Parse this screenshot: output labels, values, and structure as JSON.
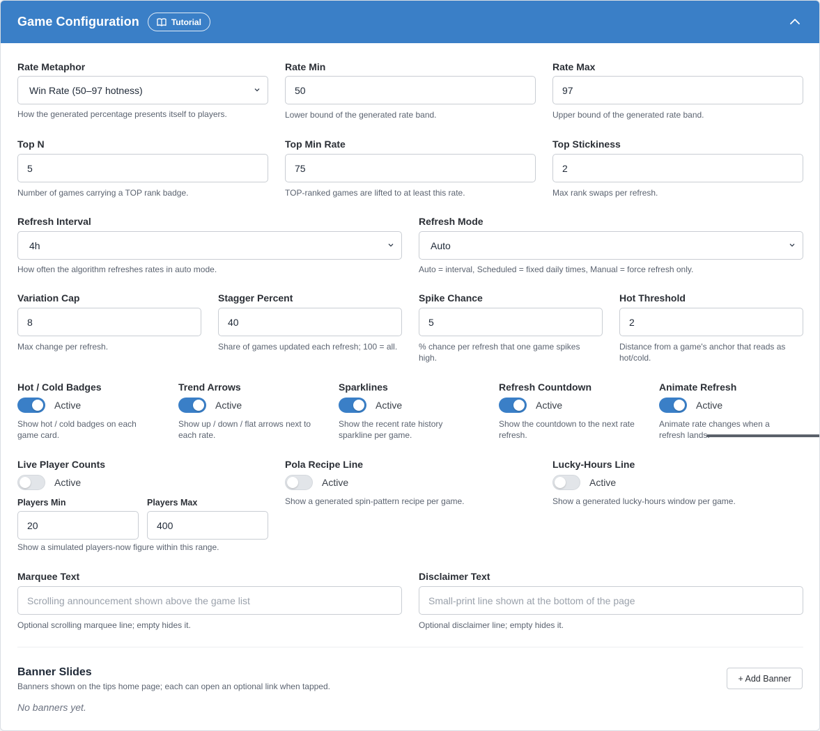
{
  "header": {
    "title": "Game Configuration",
    "tutorial_label": "Tutorial",
    "colors": {
      "accent": "#3a7fc7"
    }
  },
  "fields": {
    "rate_metaphor": {
      "label": "Rate Metaphor",
      "value": "Win Rate (50–97 hotness)",
      "help": "How the generated percentage presents itself to players."
    },
    "rate_min": {
      "label": "Rate Min",
      "value": "50",
      "help": "Lower bound of the generated rate band."
    },
    "rate_max": {
      "label": "Rate Max",
      "value": "97",
      "help": "Upper bound of the generated rate band."
    },
    "top_n": {
      "label": "Top N",
      "value": "5",
      "help": "Number of games carrying a TOP rank badge."
    },
    "top_min_rate": {
      "label": "Top Min Rate",
      "value": "75",
      "help": "TOP-ranked games are lifted to at least this rate."
    },
    "top_stickiness": {
      "label": "Top Stickiness",
      "value": "2",
      "help": "Max rank swaps per refresh."
    },
    "refresh_interval": {
      "label": "Refresh Interval",
      "value": "4h",
      "help": "How often the algorithm refreshes rates in auto mode."
    },
    "refresh_mode": {
      "label": "Refresh Mode",
      "value": "Auto",
      "help": "Auto = interval, Scheduled = fixed daily times, Manual = force refresh only."
    },
    "variation_cap": {
      "label": "Variation Cap",
      "value": "8",
      "help": "Max change per refresh."
    },
    "stagger_percent": {
      "label": "Stagger Percent",
      "value": "40",
      "help": "Share of games updated each refresh; 100 = all."
    },
    "spike_chance": {
      "label": "Spike Chance",
      "value": "5",
      "help": "% chance per refresh that one game spikes high."
    },
    "hot_threshold": {
      "label": "Hot Threshold",
      "value": "2",
      "help": "Distance from a game's anchor that reads as hot/cold."
    },
    "marquee_text": {
      "label": "Marquee Text",
      "placeholder": "Scrolling announcement shown above the game list",
      "help": "Optional scrolling marquee line; empty hides it."
    },
    "disclaimer_text": {
      "label": "Disclaimer Text",
      "placeholder": "Small-print line shown at the bottom of the page",
      "help": "Optional disclaimer line; empty hides it."
    }
  },
  "toggles": {
    "hot_cold": {
      "label": "Hot / Cold Badges",
      "state": "Active",
      "on": true,
      "help": "Show hot / cold badges on each game card."
    },
    "trend_arrows": {
      "label": "Trend Arrows",
      "state": "Active",
      "on": true,
      "help": "Show up / down / flat arrows next to each rate."
    },
    "sparklines": {
      "label": "Sparklines",
      "state": "Active",
      "on": true,
      "help": "Show the recent rate history sparkline per game."
    },
    "refresh_countdown": {
      "label": "Refresh Countdown",
      "state": "Active",
      "on": true,
      "help": "Show the countdown to the next rate refresh."
    },
    "animate_refresh": {
      "label": "Animate Refresh",
      "state": "Active",
      "on": true,
      "help": "Animate rate changes when a refresh lands."
    },
    "live_players": {
      "label": "Live Player Counts",
      "state": "Active",
      "on": false,
      "help": "Show a simulated players-now figure within this range."
    },
    "pola_recipe": {
      "label": "Pola Recipe Line",
      "state": "Active",
      "on": false,
      "help": "Show a generated spin-pattern recipe per game."
    },
    "lucky_hours": {
      "label": "Lucky-Hours Line",
      "state": "Active",
      "on": false,
      "help": "Show a generated lucky-hours window per game."
    }
  },
  "players": {
    "min_label": "Players Min",
    "min_value": "20",
    "max_label": "Players Max",
    "max_value": "400"
  },
  "banners": {
    "title": "Banner Slides",
    "description": "Banners shown on the tips home page; each can open an optional link when tapped.",
    "add_label": "+ Add Banner",
    "empty_text": "No banners yet."
  }
}
